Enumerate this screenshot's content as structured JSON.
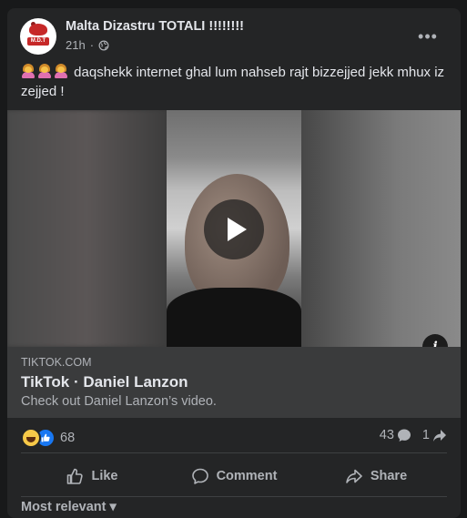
{
  "post": {
    "page_name": "Malta Dizastru TOTALI !!!!!!!!",
    "avatar_text": "M.D.T",
    "time": "21h",
    "dot": "·",
    "more": "•••",
    "emoji": "🤦‍♀️🤦‍♀️🤦‍♀️",
    "message": "daqshekk internet ghal lum nahseb rajt bizzejjed jekk mhux iz zejjed !"
  },
  "link": {
    "domain": "TIKTOK.COM",
    "title": "TikTok · Daniel Lanzon",
    "description": "Check out Daniel Lanzon’s video."
  },
  "stats": {
    "reactions_count": "68",
    "comments_count": "43",
    "shares_count": "1"
  },
  "actions": {
    "like": "Like",
    "comment": "Comment",
    "share": "Share"
  },
  "comments_filter": "Most relevant"
}
